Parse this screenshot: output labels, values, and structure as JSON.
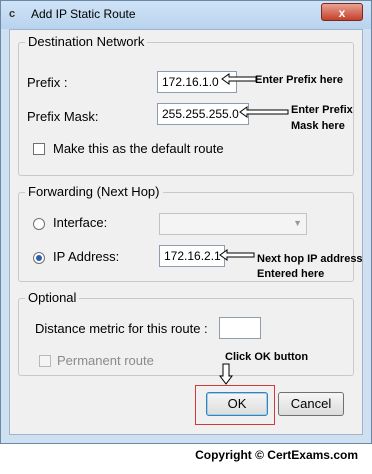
{
  "window": {
    "icon_letter": "c",
    "title": "Add IP Static Route",
    "close_label": "x"
  },
  "destination": {
    "group_label": "Destination Network",
    "prefix_label": "Prefix :",
    "prefix_value": "172.16.1.0",
    "mask_label": "Prefix Mask:",
    "mask_value": "255.255.255.0",
    "default_route_label": "Make this as the default route"
  },
  "forwarding": {
    "group_label": "Forwarding (Next Hop)",
    "interface_label": "Interface:",
    "ip_label": "IP Address:",
    "ip_value": "172.16.2.1"
  },
  "optional": {
    "group_label": "Optional",
    "metric_label": "Distance metric for this route :",
    "metric_value": "",
    "permanent_label": "Permanent route"
  },
  "buttons": {
    "ok": "OK",
    "cancel": "Cancel"
  },
  "annotations": {
    "prefix": "Enter Prefix here",
    "mask_line1": "Enter Prefix",
    "mask_line2": "Mask here",
    "nexthop_line1": "Next hop IP address",
    "nexthop_line2": "Entered here",
    "ok": "Click OK button"
  },
  "copyright": "Copyright  ©  CertExams.com"
}
